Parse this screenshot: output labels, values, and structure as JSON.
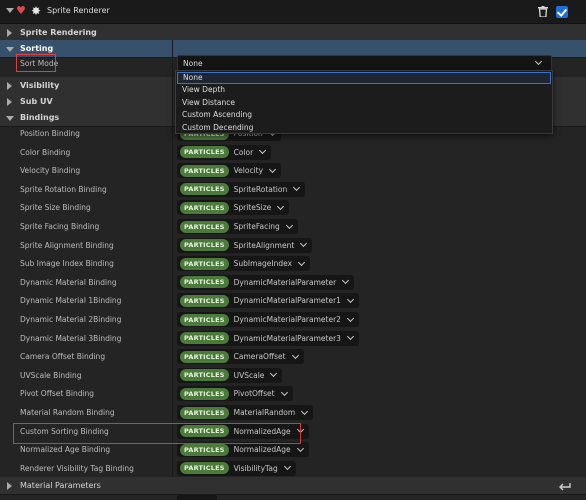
{
  "header": {
    "title": "Sprite Renderer"
  },
  "categories": {
    "sprite_rendering": "Sprite Rendering",
    "sorting": "Sorting",
    "visibility": "Visibility",
    "sub_uv": "Sub UV",
    "bindings": "Bindings",
    "material_parameters": "Material Parameters"
  },
  "sorting": {
    "sort_mode_label": "Sort Mode",
    "sort_mode_value": "None",
    "options": [
      "None",
      "View Depth",
      "View Distance",
      "Custom Ascending",
      "Custom Decending"
    ]
  },
  "bindings": {
    "pill_label": "PARTICLES",
    "rows": [
      {
        "label": "Position Binding",
        "value": "Position"
      },
      {
        "label": "Color Binding",
        "value": "Color"
      },
      {
        "label": "Velocity Binding",
        "value": "Velocity"
      },
      {
        "label": "Sprite Rotation Binding",
        "value": "SpriteRotation"
      },
      {
        "label": "Sprite Size Binding",
        "value": "SpriteSize"
      },
      {
        "label": "Sprite Facing Binding",
        "value": "SpriteFacing"
      },
      {
        "label": "Sprite Alignment Binding",
        "value": "SpriteAlignment"
      },
      {
        "label": "Sub Image Index Binding",
        "value": "SubImageIndex"
      },
      {
        "label": "Dynamic Material Binding",
        "value": "DynamicMaterialParameter"
      },
      {
        "label": "Dynamic Material 1Binding",
        "value": "DynamicMaterialParameter1"
      },
      {
        "label": "Dynamic Material 2Binding",
        "value": "DynamicMaterialParameter2"
      },
      {
        "label": "Dynamic Material 3Binding",
        "value": "DynamicMaterialParameter3"
      },
      {
        "label": "Camera Offset Binding",
        "value": "CameraOffset"
      },
      {
        "label": "UVScale Binding",
        "value": "UVScale"
      },
      {
        "label": "Pivot Offset Binding",
        "value": "PivotOffset"
      },
      {
        "label": "Material Random Binding",
        "value": "MaterialRandom"
      },
      {
        "label": "Custom Sorting Binding",
        "value": "NormalizedAge"
      },
      {
        "label": "Normalized Age Binding",
        "value": "NormalizedAge"
      },
      {
        "label": "Renderer Visibility Tag Binding",
        "value": "VisibilityTag"
      }
    ]
  },
  "colors": {
    "accent": "#1e6fd8",
    "particles_pill": "#4b7a3b",
    "selected_category": "#37506c",
    "highlight": "#d04030"
  },
  "icons": [
    "chevron-down-icon",
    "heart-icon",
    "sparkle-icon",
    "trash-icon",
    "checkbox-icon",
    "reset-arrow-icon"
  ]
}
